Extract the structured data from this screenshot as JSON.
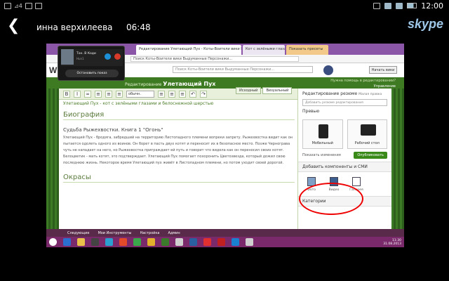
{
  "status_bar": {
    "left_text": "⊿4",
    "time": "12:00",
    "icons": [
      "notification-icon",
      "mail-icon",
      "edit-icon",
      "mute-icon",
      "wifi-icon",
      "signal-icon",
      "battery-icon"
    ]
  },
  "call": {
    "contact_name": "инна верхилеева",
    "duration": "06:48",
    "app_logo": "skype"
  },
  "screen_share": {
    "browser": {
      "tabs": [
        "Редактирование Улетающий Пух - Коты-Воители вики Выдуманные Персонажи",
        "Кот с зелёными глазами",
        "Показать пресеты"
      ],
      "address": "Поиск Коты-Воители вики Выдуманные Персонажи..."
    },
    "wikia": {
      "logo": "W",
      "search_placeholder": "Поиск Коты-Воители вики Выдуманные Персонажи...",
      "button": "Начать вики"
    },
    "editor": {
      "title_prefix": "Редактирование",
      "title": "Улетающий Пух",
      "help": "Нужна помощь в редактировании?",
      "help_link": "Управление",
      "mode_tabs": [
        "Исходный",
        "Визуальный"
      ],
      "format_select": "обычн.",
      "line1": "Улетающий Пух - кот с зелёными глазами и белоснежной шерстью",
      "heading_bio": "Биография",
      "subheading": "Судьба Рыжехвостки. Книга 1 \"Огонь\"",
      "paragraph": "Улетающий Пух - бродяга, забредший на территорию Листопадного племени вопреки запрету. Рыжехвостка видит как он пытается одолеть одного из воинов. Он борет в пасть двух котят и переносит их в безопасное место. Позже Чернограва чуть не нападает на него, но Рыжехвостка приграждает ей путь и говорит что видела как он переносил своих котят. Белоцветик - мать котят, это подтверждает. Улетающий Пух помогает похоронить Цветозвезда, который дожил свою последнюю жизнь. Некоторое время Улетающий пух живёт в Листопадном племени, но потом уходит своей дорогой.",
      "heading_colors": "Окрасы"
    },
    "right_panel": {
      "summary_label": "Редактирование резюме",
      "minor_edit": "Малая правка",
      "summary_placeholder": "Добавить резюме редактирования",
      "preview_label": "Превью",
      "mobile": "Мобильный",
      "desktop": "Рабочий стол",
      "show_changes": "Показать изменения",
      "publish": "Опубликовать",
      "add_components": "Добавить компоненты и СМИ",
      "media": [
        "Фото",
        "Видео",
        "Галерея"
      ],
      "categories": "Категории"
    },
    "footer": [
      "Следующие",
      "Мои Инструменты",
      "Настройка",
      "Админ"
    ],
    "taskbar": {
      "time": "11:30",
      "date": "31.08.2013"
    },
    "self_view": {
      "name": "Тон. В Коди",
      "sub": "Hun1",
      "stop_label": "Остановить показ"
    }
  }
}
